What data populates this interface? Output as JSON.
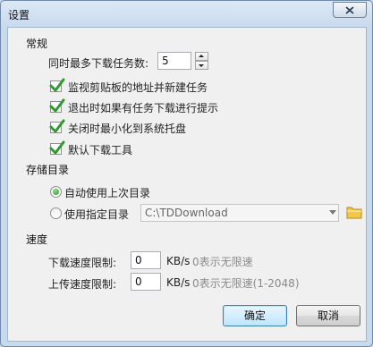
{
  "window": {
    "title": "设置"
  },
  "general": {
    "heading": "常规",
    "max_tasks_label": "同时最多下载任务数:",
    "max_tasks_value": "5",
    "checkboxes": [
      {
        "label": "监视剪贴板的地址并新建任务",
        "checked": true
      },
      {
        "label": "退出时如果有任务下载进行提示",
        "checked": true
      },
      {
        "label": "关闭时最小化到系统托盘",
        "checked": true
      },
      {
        "label": "默认下载工具",
        "checked": true
      }
    ]
  },
  "storage": {
    "heading": "存储目录",
    "option_auto": "自动使用上次目录",
    "option_custom": "使用指定目录",
    "path_value": "C:\\TDDownload",
    "selected": "auto"
  },
  "speed": {
    "heading": "速度",
    "download_label": "下载速度限制:",
    "download_value": "0",
    "download_unit": "KB/s",
    "download_hint": "0表示无限速",
    "upload_label": "上传速度限制:",
    "upload_value": "0",
    "upload_unit": "KB/s",
    "upload_hint": "0表示无限速(1-2048)"
  },
  "buttons": {
    "ok": "确定",
    "cancel": "取消"
  },
  "colors": {
    "check": "#2f9a2f",
    "folder": "#e8b840"
  },
  "icons": {
    "close": "close-icon",
    "check": "checkmark-icon",
    "folder": "folder-icon",
    "dropdown": "chevron-down-icon"
  }
}
